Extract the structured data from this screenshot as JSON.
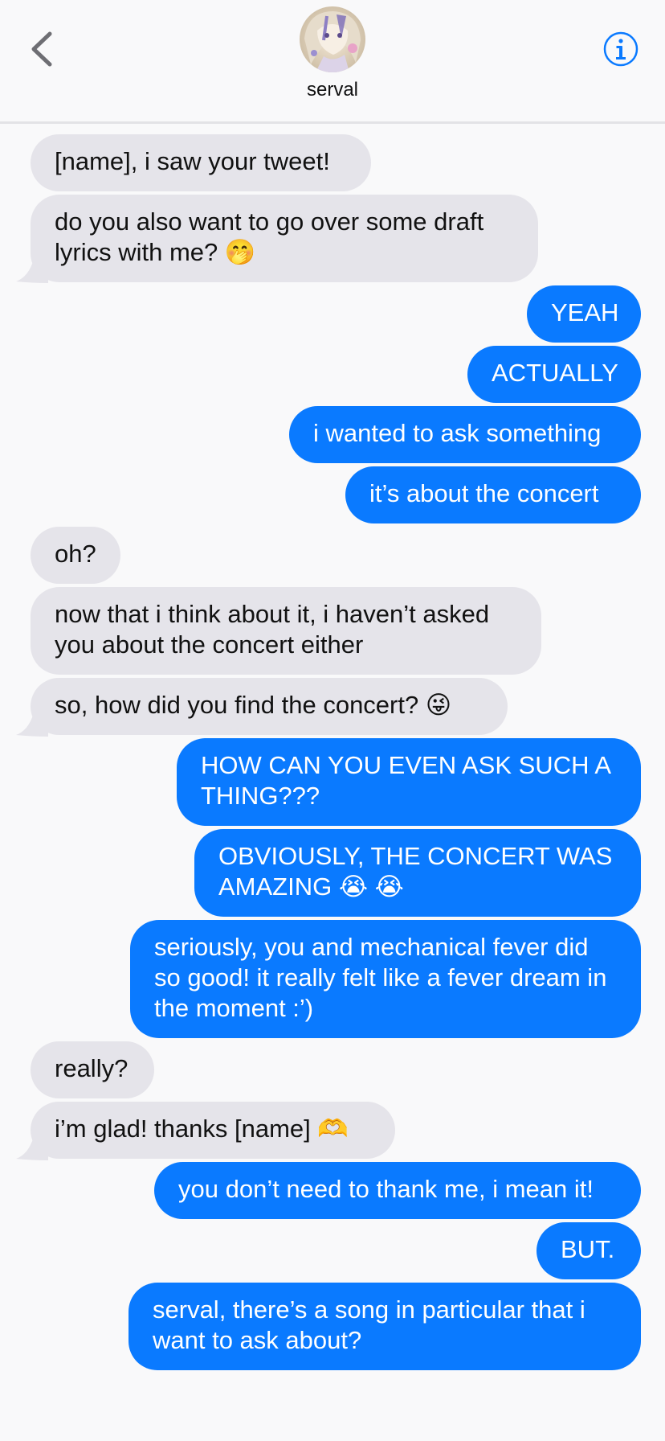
{
  "header": {
    "contact_name": "serval",
    "back_icon": "chevron-left-icon",
    "info_icon": "info-circle-icon",
    "accent": "#0a7aff"
  },
  "messages": [
    {
      "from": "them",
      "text": "[name], i saw your tweet!"
    },
    {
      "from": "them",
      "text": "do you also want to go over some draft lyrics with me? 🤭"
    },
    {
      "from": "me",
      "text": "YEAH"
    },
    {
      "from": "me",
      "text": "ACTUALLY"
    },
    {
      "from": "me",
      "text": "i wanted to ask something"
    },
    {
      "from": "me",
      "text": "it’s about the concert"
    },
    {
      "from": "them",
      "text": "oh?"
    },
    {
      "from": "them",
      "text": "now that i think about it, i haven’t asked you about the concert either"
    },
    {
      "from": "them",
      "text": "so, how did you find the concert? 😜"
    },
    {
      "from": "me",
      "text": "HOW CAN YOU EVEN ASK SUCH A THING???"
    },
    {
      "from": "me",
      "text": "OBVIOUSLY, THE CONCERT WAS AMAZING 😭 😭"
    },
    {
      "from": "me",
      "text": "seriously, you and mechanical fever did so good! it really felt like a fever dream in the moment :’)"
    },
    {
      "from": "them",
      "text": "really?"
    },
    {
      "from": "them",
      "text": "i’m glad! thanks [name] 🫶"
    },
    {
      "from": "me",
      "text": "you don’t need to thank me, i mean it!"
    },
    {
      "from": "me",
      "text": "BUT."
    },
    {
      "from": "me",
      "text": "serval, there’s a song in particular that i want to ask about?"
    }
  ],
  "colors": {
    "incoming_bubble": "#e5e4ea",
    "outgoing_bubble": "#0a7aff",
    "background": "#f9f9fa"
  }
}
